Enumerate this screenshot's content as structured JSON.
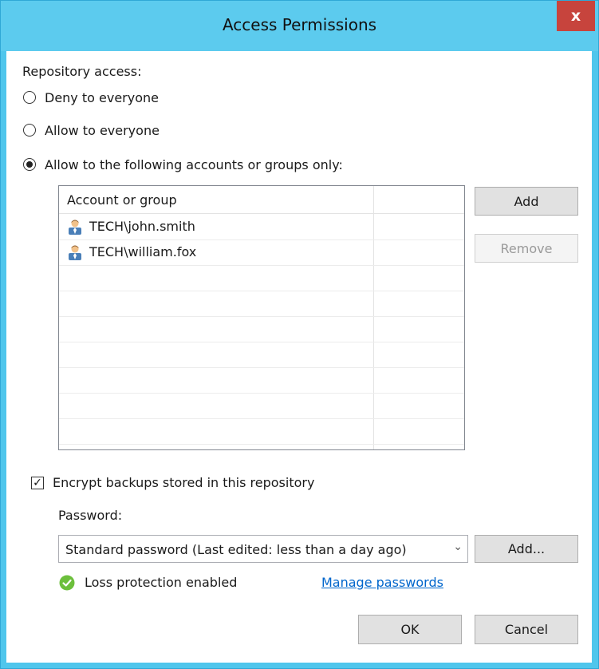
{
  "window": {
    "title": "Access Permissions",
    "close_glyph": "x"
  },
  "access": {
    "label": "Repository access:",
    "options": [
      {
        "label": "Deny to everyone",
        "selected": false
      },
      {
        "label": "Allow to everyone",
        "selected": false
      },
      {
        "label": "Allow to the following accounts or groups only:",
        "selected": true
      }
    ]
  },
  "accounts": {
    "column_header": "Account or group",
    "rows": [
      {
        "name": "TECH\\john.smith",
        "icon": "user-icon"
      },
      {
        "name": "TECH\\william.fox",
        "icon": "user-icon"
      }
    ],
    "add_label": "Add",
    "remove_label": "Remove"
  },
  "encryption": {
    "checkbox_label": "Encrypt backups stored in this repository",
    "checked": true,
    "password_label": "Password:",
    "password_value": "Standard password (Last edited: less than a day ago)",
    "add_label": "Add...",
    "status_text": "Loss protection enabled",
    "status_icon": "check-circle-icon",
    "manage_link": "Manage passwords"
  },
  "footer": {
    "ok_label": "OK",
    "cancel_label": "Cancel"
  },
  "colors": {
    "titlebar": "#5ccbee",
    "close_button": "#c7443d",
    "link": "#0066cc",
    "status_ok": "#6cbf3c"
  }
}
